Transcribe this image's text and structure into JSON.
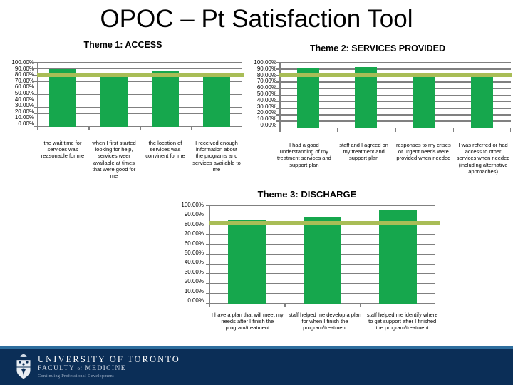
{
  "slide": {
    "title": "OPOC – Pt Satisfaction Tool"
  },
  "colors": {
    "bar_green": "#16A74D",
    "target_line": "#A9BD56",
    "gridline_gray": "#808080",
    "footer_blue": "#0B2E57"
  },
  "charts": [
    {
      "id": "theme1",
      "title": "Theme 1: ACCESS"
    },
    {
      "id": "theme2",
      "title": "Theme 2: SERVICES PROVIDED"
    },
    {
      "id": "theme3",
      "title": "Theme 3: DISCHARGE"
    }
  ],
  "axis": {
    "ticks": [
      "100.00%",
      "90.00%",
      "80.00%",
      "70.00%",
      "60.00%",
      "50.00%",
      "40.00%",
      "30.00%",
      "20.00%",
      "10.00%",
      "0.00%"
    ]
  },
  "footer": {
    "line1": "UNIVERSITY OF TORONTO",
    "line2_a": "FACULTY",
    "line2_of": "of",
    "line2_b": "MEDICINE",
    "line3": "Continuing Professional Development",
    "logo_icon": "uoft-crest-icon"
  },
  "chart_data": [
    {
      "type": "bar",
      "title": "Theme 1: ACCESS",
      "xlabel": "",
      "ylabel": "",
      "ylim": [
        0,
        100
      ],
      "ytick_labels": [
        "100.00%",
        "90.00%",
        "80.00%",
        "70.00%",
        "60.00%",
        "50.00%",
        "40.00%",
        "30.00%",
        "20.00%",
        "10.00%",
        "0.00%"
      ],
      "grid": true,
      "legend": "none",
      "categories": [
        "the wait time for services was reasonable for me",
        "when I first started looking for help, services weer available at times that were good for me",
        "the location of services was convinent for me",
        "I received enough information about the programs and services available to me"
      ],
      "series": [
        {
          "name": "result",
          "type": "bar",
          "values": [
            89,
            83,
            86,
            84
          ]
        },
        {
          "name": "target",
          "type": "line",
          "values": [
            80,
            80,
            80,
            80
          ]
        }
      ]
    },
    {
      "type": "bar",
      "title": "Theme 2: SERVICES PROVIDED",
      "xlabel": "",
      "ylabel": "",
      "ylim": [
        0,
        100
      ],
      "ytick_labels": [
        "100.00%",
        "90.00%",
        "80.00%",
        "70.00%",
        "60.00%",
        "50.00%",
        "40.00%",
        "30.00%",
        "20.00%",
        "10.00%",
        "0.00%"
      ],
      "grid": true,
      "legend": "none",
      "categories": [
        "I had a good understanding of my treatment services and support plan",
        "staff and I agreed on my treatment and support plan",
        "responses to my crises or urgent needs were provided when needed",
        "I was referred or had access to other services when needed (including alternative approaches)"
      ],
      "series": [
        {
          "name": "result",
          "type": "bar",
          "values": [
            91,
            93,
            82,
            79
          ]
        },
        {
          "name": "target",
          "type": "line",
          "values": [
            80,
            80,
            80,
            80
          ]
        }
      ]
    },
    {
      "type": "bar",
      "title": "Theme 3: DISCHARGE",
      "xlabel": "",
      "ylabel": "",
      "ylim": [
        0,
        100
      ],
      "ytick_labels": [
        "100.00%",
        "90.00%",
        "80.00%",
        "70.00%",
        "60.00%",
        "50.00%",
        "40.00%",
        "30.00%",
        "20.00%",
        "10.00%",
        "0.00%"
      ],
      "grid": true,
      "legend": "none",
      "categories": [
        "I have a plan that will meet my needs after I finish the program/treatment",
        "staff helped me develop a plan for when I finish the program/treatment",
        "staff helped me identify where to get support after I finished the program/treatment"
      ],
      "series": [
        {
          "name": "result",
          "type": "bar",
          "values": [
            85,
            87,
            95
          ]
        },
        {
          "name": "target",
          "type": "line",
          "values": [
            82,
            82,
            82
          ]
        }
      ]
    }
  ]
}
